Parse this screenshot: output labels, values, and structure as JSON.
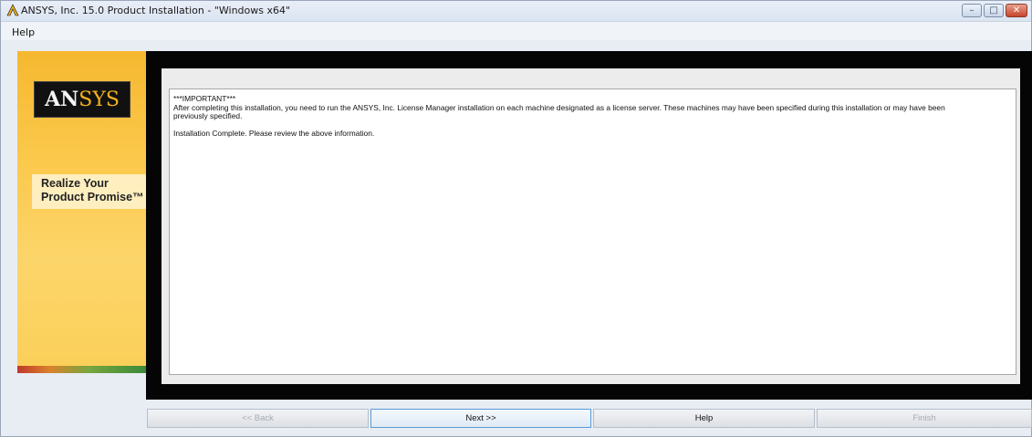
{
  "window": {
    "title": "ANSYS, Inc. 15.0 Product Installation - \"Windows x64\"",
    "controls": {
      "minimize_glyph": "–",
      "maximize_glyph": "□",
      "close_glyph": "✕"
    }
  },
  "menu": {
    "items": [
      {
        "label": "Help"
      }
    ]
  },
  "sidebar": {
    "logo": {
      "part1": "AN",
      "part2": "SYS"
    },
    "tagline_line1": "Realize Your",
    "tagline_line2": "Product Promise™"
  },
  "content": {
    "lines": [
      "***IMPORTANT***",
      "After completing this installation, you need to run the ANSYS, Inc. License Manager installation on each machine designated as a license server.  These machines may have been specified during this installation or may have been",
      "previously specified.",
      "Installation Complete. Please review the above information."
    ]
  },
  "buttons": {
    "back": {
      "label": "<< Back",
      "enabled": false
    },
    "next": {
      "label": "Next >>",
      "enabled": true
    },
    "help": {
      "label": "Help",
      "enabled": true
    },
    "finish": {
      "label": "Finish",
      "enabled": false
    }
  },
  "colors": {
    "accent_orange": "#f4b01e",
    "title_bar": "#dbe4f1",
    "close_red": "#c8432b"
  }
}
